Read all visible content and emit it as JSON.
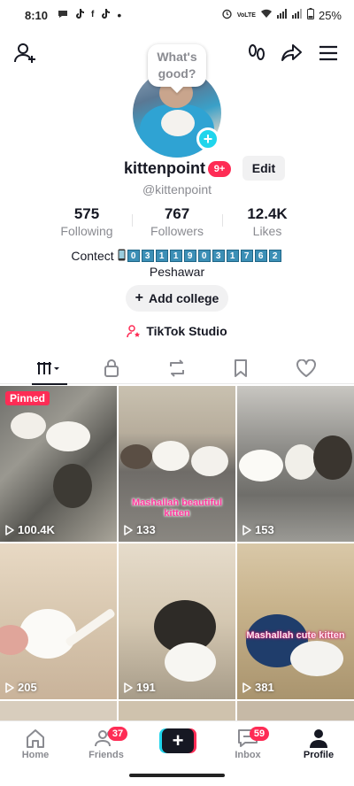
{
  "status_bar": {
    "time": "8:10",
    "battery": "25%",
    "network_label": "VoLTE"
  },
  "profile": {
    "bubble_text": "What's good?",
    "username": "kittenpoint",
    "notification_badge": "9+",
    "edit_label": "Edit",
    "handle": "@kittenpoint"
  },
  "stats": [
    {
      "value": "575",
      "label": "Following"
    },
    {
      "value": "767",
      "label": "Followers"
    },
    {
      "value": "12.4K",
      "label": "Likes"
    }
  ],
  "bio": {
    "label": "Contect",
    "digits": [
      "0",
      "3",
      "1",
      "1",
      "9",
      "0",
      "3",
      "1",
      "7",
      "6",
      "2"
    ],
    "city": "Peshawar"
  },
  "add_college_label": "Add college",
  "studio_label": "TikTok Studio",
  "videos": [
    {
      "views": "100.4K",
      "pinned": "Pinned",
      "overlay": ""
    },
    {
      "views": "133",
      "pinned": "",
      "overlay": "Mashallah  beautiful kitten"
    },
    {
      "views": "153",
      "pinned": "",
      "overlay": ""
    },
    {
      "views": "205",
      "pinned": "",
      "overlay": ""
    },
    {
      "views": "191",
      "pinned": "",
      "overlay": ""
    },
    {
      "views": "381",
      "pinned": "",
      "overlay": "Mashallah cute kitten"
    }
  ],
  "bottom_nav": {
    "home": "Home",
    "friends": "Friends",
    "friends_badge": "37",
    "inbox": "Inbox",
    "inbox_badge": "59",
    "profile": "Profile"
  },
  "colors": {
    "accent_red": "#fe2c55",
    "accent_cyan": "#20d5ec",
    "text_primary": "#161823",
    "text_secondary": "#8a8b91"
  }
}
